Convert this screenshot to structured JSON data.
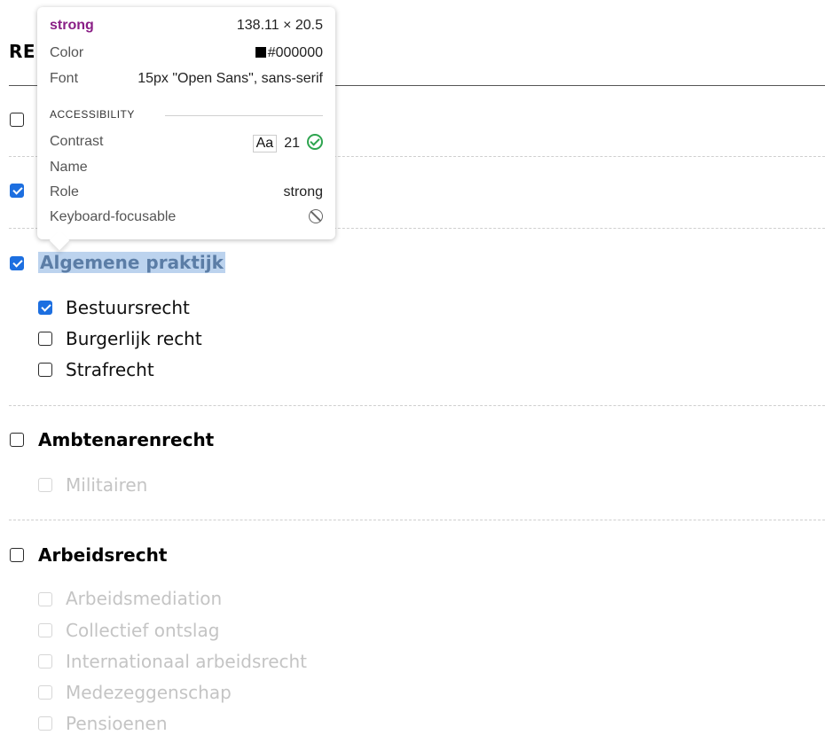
{
  "page": {
    "heading_fragment": "RE",
    "groups": [
      {
        "label": "Algemene praktijk",
        "checked": true,
        "highlighted": true,
        "items": [
          {
            "label": "Bestuursrecht",
            "checked": true,
            "disabled": false
          },
          {
            "label": "Burgerlijk recht",
            "checked": false,
            "disabled": false
          },
          {
            "label": "Strafrecht",
            "checked": false,
            "disabled": false
          }
        ]
      },
      {
        "label": "Ambtenarenrecht",
        "checked": false,
        "items": [
          {
            "label": "Militairen",
            "checked": false,
            "disabled": true
          }
        ]
      },
      {
        "label": "Arbeidsrecht",
        "checked": false,
        "items": [
          {
            "label": "Arbeidsmediation",
            "checked": false,
            "disabled": true
          },
          {
            "label": "Collectief ontslag",
            "checked": false,
            "disabled": true
          },
          {
            "label": "Internationaal arbeidsrecht",
            "checked": false,
            "disabled": true
          },
          {
            "label": "Medezeggenschap",
            "checked": false,
            "disabled": true
          },
          {
            "label": "Pensioenen",
            "checked": false,
            "disabled": true
          }
        ]
      }
    ],
    "hidden_rows": [
      {
        "checked": false
      },
      {
        "checked": true
      }
    ]
  },
  "tooltip": {
    "tag": "strong",
    "size": "138.11 × 20.5",
    "color_label": "Color",
    "color_value": "#000000",
    "font_label": "Font",
    "font_value": "15px \"Open Sans\", sans-serif",
    "section_title": "ACCESSIBILITY",
    "contrast_label": "Contrast",
    "contrast_aa": "Aa",
    "contrast_value": "21",
    "name_label": "Name",
    "role_label": "Role",
    "role_value": "strong",
    "focus_label": "Keyboard-focusable"
  },
  "colors": {
    "checkbox_checked": "#1d6fe0",
    "highlight_bg": "#bcd3ee",
    "tooltip_tag": "#8a1f86",
    "contrast_pass": "#2ea44f"
  }
}
